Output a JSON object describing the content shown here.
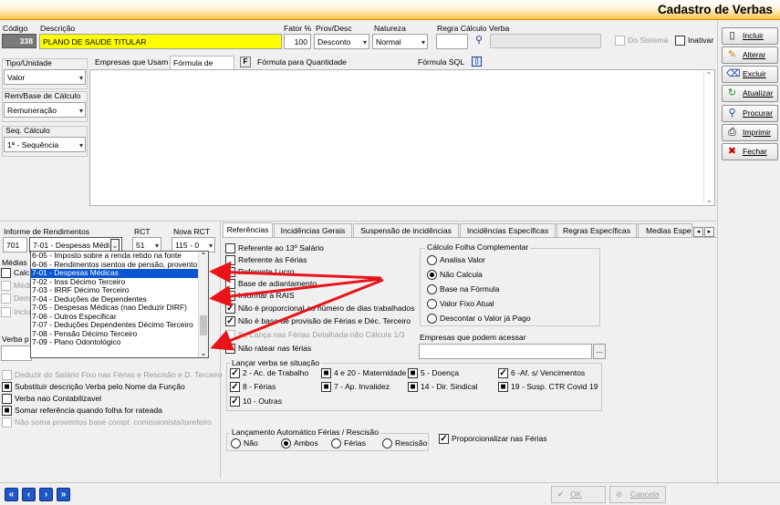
{
  "window": {
    "title": "Cadastro de Verbas"
  },
  "fields": {
    "codigo": {
      "label": "Código",
      "value": "338"
    },
    "descricao": {
      "label": "Descrição",
      "value": "PLANO DE SAUDE TITULAR"
    },
    "fator": {
      "label": "Fator %",
      "value": "100"
    },
    "prov_desc": {
      "label": "Prov/Desc",
      "value": "Desconto"
    },
    "natureza": {
      "label": "Natureza",
      "value": "Normal"
    },
    "regra": {
      "label": "Regra Cálculo Verba",
      "value": ""
    },
    "do_sistema": {
      "label": "Do Sistema",
      "checked": false
    },
    "inativar": {
      "label": "Inativar",
      "checked": false
    },
    "tipo_unidade": {
      "label": "Tipo/Unidade",
      "value": "Valor"
    },
    "rem_base": {
      "label": "Rem/Base de Cálculo",
      "value": "Remuneração"
    },
    "seq_calculo": {
      "label": "Seq. Cálculo",
      "value": "1ª - Sequência"
    }
  },
  "top_tabs": [
    "Empresas que Usam",
    "Fórmula de Valor",
    "F",
    "Fórmula para Quantidade",
    "Fórmula SQL",
    "[]"
  ],
  "informe": {
    "label": "Informe de Rendimentos",
    "code": "701",
    "value": "7-01 - Despesas Médi",
    "rct_label": "RCT",
    "rct_value": "51",
    "nova_rct_label": "Nova RCT",
    "nova_rct_value": "115 - 0"
  },
  "informe_options": [
    "6-05 - Imposto sobre a renda retido na fonte",
    "6-06 - Rendimentos isentos de pensão, provento",
    "7-01 - Despesas Médicas",
    "7-02 - Inss Décimo Terceiro",
    "7-03 - IRRF Décimo Terceiro",
    "7-04 - Deduções de Dependentes",
    "7-05 - Despesas Médicas (nao Deduzir DIRF)",
    "7-06 - Outros Especificar",
    "7-07 - Deduções Dependentes Décimo Terceiro",
    "7-08 - Pensão Décimo Terceiro",
    "7-09 - Plano Odontológico"
  ],
  "informe_selected_index": 2,
  "left_hidden": {
    "medias": "Médias",
    "calc": "Calc",
    "medi": "Médi",
    "dema": "Dema",
    "inclu": "Inclu",
    "verba_p": "Verba p"
  },
  "left_options": [
    {
      "label": "Deduzir do Salário Fixo nas  Férias e Rescisão e D. Terceiro",
      "checked": false,
      "disabled": true
    },
    {
      "label": "Substituir descrição Verba pelo Nome da Função",
      "checked": true,
      "disabled": false
    },
    {
      "label": "Verba nao Contabilizavel",
      "checked": false,
      "disabled": false
    },
    {
      "label": "Somar referência quando folha for rateada",
      "checked": true,
      "disabled": false
    },
    {
      "label": "Não soma proventos base compl. comissionista/tarefeiro",
      "checked": false,
      "disabled": true
    }
  ],
  "bottom_tabs": [
    "Referências",
    "Incidências Gerais",
    "Suspensão de incidências",
    "Incidências Específicas",
    "Regras Específicas",
    "Medias Espe"
  ],
  "referencias": [
    {
      "label": "Referente ao 13º Salário",
      "checked": false,
      "disabled": false
    },
    {
      "label": "Referente às Férias",
      "checked": false,
      "disabled": false
    },
    {
      "label": "Referente Lucro",
      "checked": false,
      "disabled": false
    },
    {
      "label": "Base de adiantamento",
      "checked": false,
      "disabled": false
    },
    {
      "label": "Informar à RAIS",
      "checked": false,
      "disabled": false
    },
    {
      "label": "Não é proporcional ao número de dias trabalhados",
      "checked": true,
      "disabled": false
    },
    {
      "label": "Não é base de provisão de Férias e Déc. Terceiro",
      "checked": true,
      "disabled": false
    },
    {
      "label": "Se Lança nas Férias Detalhada não Cálcula 1/3",
      "checked": false,
      "disabled": true
    },
    {
      "label": "Não ratear nas férias",
      "checked": false,
      "disabled": false
    }
  ],
  "calc_folha": {
    "title": "Cálculo Folha Complementar",
    "options": [
      "Analisa Valor",
      "Não Calcula",
      "Base na Fórmula",
      "Valor Fixo Atual",
      "Descontar o Valor já Pago"
    ],
    "selected": 1
  },
  "empresas_acessar": {
    "label": "Empresas que podem acessar",
    "value": "",
    "button": "..."
  },
  "lancar": {
    "title": "Lançar verba se situação",
    "items": [
      {
        "label": "2 - Ac. de Trabalho",
        "checked": true
      },
      {
        "label": "4 e 20 - Maternidade",
        "checked": true
      },
      {
        "label": "5 - Doença",
        "checked": true
      },
      {
        "label": "6 -Af. s/ Vencimentos",
        "checked": true
      },
      {
        "label": "8 - Férias",
        "checked": true
      },
      {
        "label": "7 - Ap. Invalidez",
        "checked": true
      },
      {
        "label": "14 - Dir. Sindical",
        "checked": true
      },
      {
        "label": "19 - Susp. CTR Covid 19",
        "checked": true
      },
      {
        "label": "10 - Outras",
        "checked": true
      }
    ]
  },
  "lanc_auto": {
    "title": "Lançamento Automático Férias / Rescisão",
    "options": [
      "Não",
      "Ambos",
      "Férias",
      "Rescisão"
    ],
    "selected": 1
  },
  "proporcionalizar": {
    "label": "Proporcionalizar nas Férias",
    "checked": true
  },
  "side_buttons": [
    {
      "label": "Incluir",
      "icon": "document-icon"
    },
    {
      "label": "Alterar",
      "icon": "pencil-icon"
    },
    {
      "label": "Excluir",
      "icon": "delete-icon"
    },
    {
      "label": "Atualizar",
      "icon": "refresh-icon"
    },
    {
      "label": "Procurar",
      "icon": "binoculars-icon"
    },
    {
      "label": "Imprimir",
      "icon": "printer-icon"
    },
    {
      "label": "Fechar",
      "icon": "close-icon"
    }
  ],
  "footer": {
    "ok": "OK",
    "cancel": "Cancela"
  },
  "nav_buttons": [
    "first-icon",
    "prev-icon",
    "next-icon",
    "last-icon"
  ]
}
